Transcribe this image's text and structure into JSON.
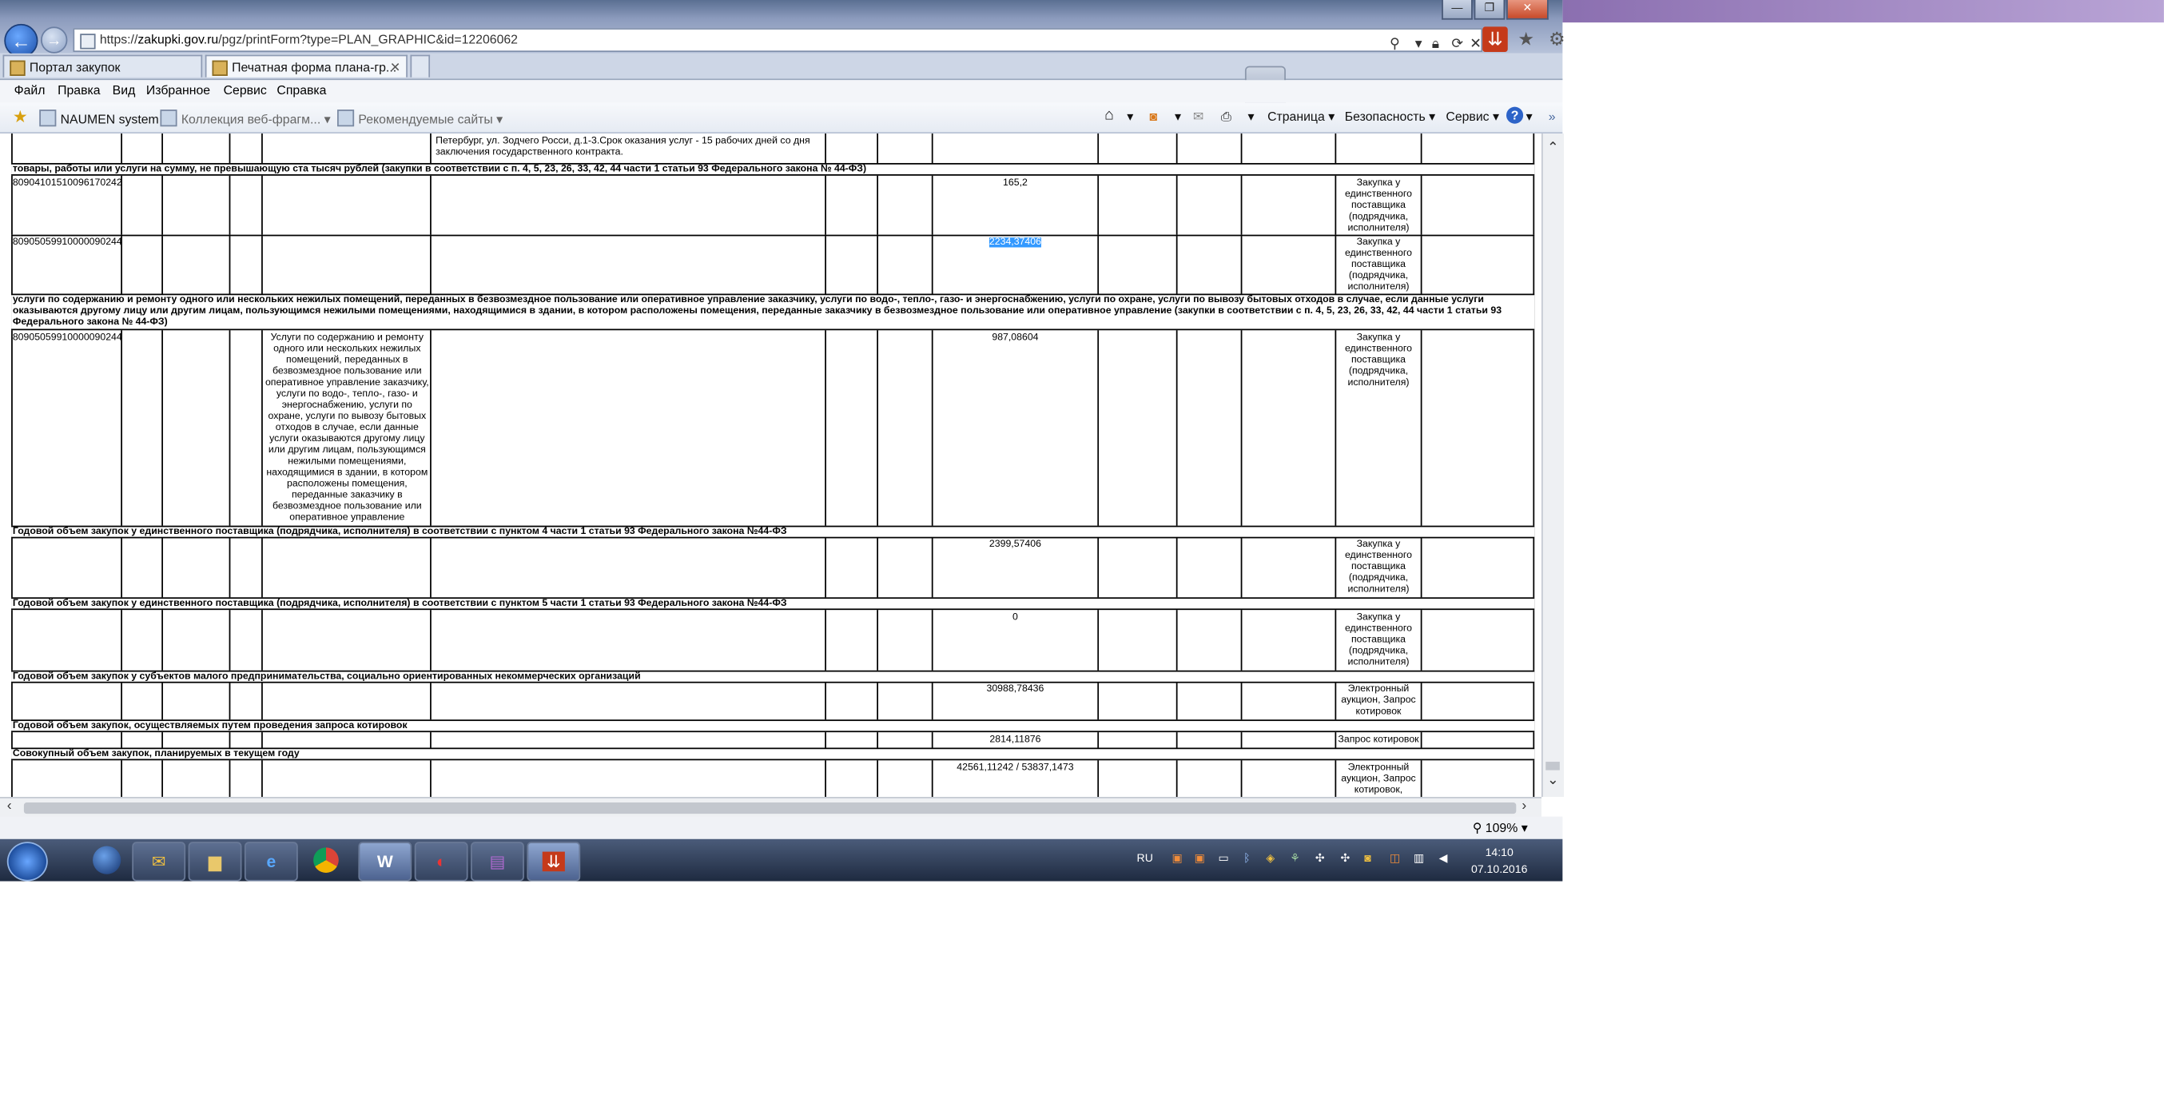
{
  "browser": {
    "url_prefix": "https://",
    "url_host": "zakupki.gov.ru",
    "url_path": "/pgz/printForm?type=PLAN_GRAPHIC&id=12206062",
    "tabs": [
      {
        "label": "Портал закупок"
      },
      {
        "label": "Печатная форма плана-гр..."
      }
    ],
    "tab_close": "✕",
    "menu": [
      "Файл",
      "Правка",
      "Вид",
      "Избранное",
      "Сервис",
      "Справка"
    ],
    "favorites": [
      {
        "label": "NAUMEN system"
      },
      {
        "label": "Коллекция веб-фрагм..."
      },
      {
        "label": "Рекомендуемые сайты"
      }
    ],
    "commands": [
      "Страница",
      "Безопасность",
      "Сервис"
    ],
    "zoom": "109%"
  },
  "table": {
    "top_address_line1": "Петербург, ул. Зодчего Росси, д.1-3.Срок оказания услуг - 15 рабочих дней со дня",
    "top_address_line2": "заключения государственного контракта.",
    "section1": "товары, работы или услуги на сумму, не превышающую ста тысяч рублей (закупки в соответствии с п. 4, 5, 23, 26, 33, 42, 44 части 1 статьи 93 Федерального закона № 44-ФЗ)",
    "method_single": "Закупка у единственного поставщика (подрядчика, исполнителя)",
    "row1": {
      "code": "80904101510096170242",
      "amount": "165,2"
    },
    "row2": {
      "code": "80905059910000090244",
      "amount": "2234,37406"
    },
    "section2": "услуги по содержанию и ремонту одного или нескольких нежилых помещений, переданных в безвозмездное пользование или оперативное управление заказчику, услуги по водо-, тепло-, газо- и энергоснабжению, услуги по охране, услуги по вывозу бытовых отходов в случае, если данные услуги оказываются другому лицу или другим лицам, пользующимся нежилыми помещениями, находящимися в здании, в котором расположены помещения, переданные заказчику в безвозмездное пользование или оперативное управление (закупки в соответствии с п. 4, 5, 23, 26, 33, 42, 44 части 1 статьи 93 Федерального закона № 44-ФЗ)",
    "row3": {
      "code": "80905059910000090244",
      "description": "Услуги по содержанию и ремонту одного или нескольких нежилых помещений, переданных в безвозмездное пользование или оперативное управление заказчику, услуги по водо-, тепло-, газо- и энергоснабжению, услуги по охране, услуги по вывозу бытовых отходов в случае, если данные услуги оказываются другому лицу или другим лицам, пользующимся нежилыми помещениями, находящимися в здании, в котором расположены помещения, переданные заказчику в безвозмездное пользование или оперативное управление",
      "amount": "987,08604"
    },
    "section3": "Годовой объем закупок у единственного поставщика (подрядчика, исполнителя) в соответствии с пунктом 4 части 1 статьи 93 Федерального закона №44-ФЗ",
    "row4": {
      "amount": "2399,57406"
    },
    "section4": "Годовой объем закупок у единственного поставщика (подрядчика, исполнителя) в соответствии с пунктом 5 части 1 статьи 93 Федерального закона №44-ФЗ",
    "row5": {
      "amount": "0"
    },
    "section5": "Годовой объем закупок у субъектов малого предпринимательства, социально ориентированных некоммерческих организаций",
    "row6": {
      "amount": "30988,78436",
      "method": "Электронный аукцион, Запрос котировок"
    },
    "section6": "Годовой объем закупок, осуществляемых путем проведения запроса котировок",
    "row7": {
      "amount": "2814,11876",
      "method": "Запрос котировок"
    },
    "section7": "Совокупный объем закупок, планируемых в текущем году",
    "row8": {
      "amount": "42561,11242 / 53837,1473",
      "method": "Электронный аукцион, Запрос котировок,"
    }
  },
  "taskbar": {
    "lang": "RU",
    "time": "14:10",
    "date": "07.10.2016"
  },
  "colors": {
    "selection": "#3399ff",
    "titlebar": "#8c9bbd"
  },
  "icons": [
    "back-arrow-icon",
    "forward-arrow-icon",
    "search-icon",
    "lock-icon",
    "refresh-icon",
    "home-icon",
    "rss-icon",
    "mail-icon",
    "print-icon",
    "help-icon",
    "star-icon",
    "gear-icon",
    "windows-start-icon"
  ]
}
